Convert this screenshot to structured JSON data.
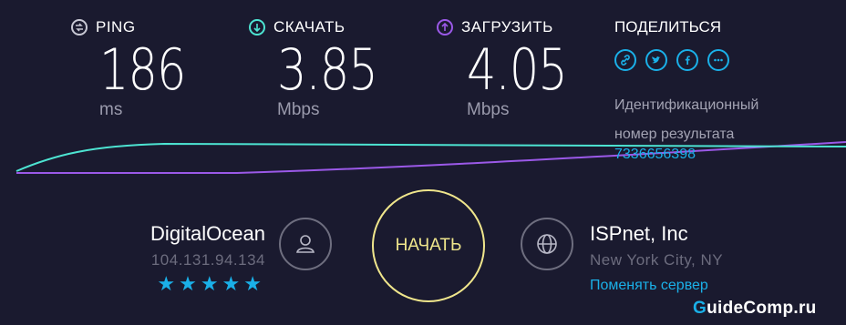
{
  "colors": {
    "background": "#1a1a2f",
    "accent": "#1ab0e8",
    "download": "#4de4d2",
    "upload": "#9b59e8",
    "start_button": "#f0e68c"
  },
  "metrics": {
    "ping": {
      "label": "PING",
      "value": "186",
      "unit": "ms",
      "icon": "ping-icon"
    },
    "download": {
      "label": "СКАЧАТЬ",
      "value": "3.85",
      "unit": "Mbps",
      "icon": "download-arrow-icon"
    },
    "upload": {
      "label": "ЗАГРУЗИТЬ",
      "value": "4.05",
      "unit": "Mbps",
      "icon": "upload-arrow-icon"
    }
  },
  "share": {
    "title": "ПОДЕЛИТЬСЯ",
    "icons": [
      "link-icon",
      "twitter-icon",
      "facebook-icon",
      "more-icon"
    ],
    "result_label": "Идентификационный номер результата",
    "result_id": "7336656398"
  },
  "server": {
    "name": "DigitalOcean",
    "ip": "104.131.94.134",
    "rating": 5,
    "stars": "★★★★★"
  },
  "start_button": {
    "label": "НАЧАТЬ"
  },
  "isp": {
    "name": "ISPnet, Inc",
    "location": "New York City, NY",
    "change_server": "Поменять сервер"
  },
  "watermark": {
    "text": "GuideComp.ru",
    "first_letter": "G",
    "rest": "uideComp.ru"
  }
}
